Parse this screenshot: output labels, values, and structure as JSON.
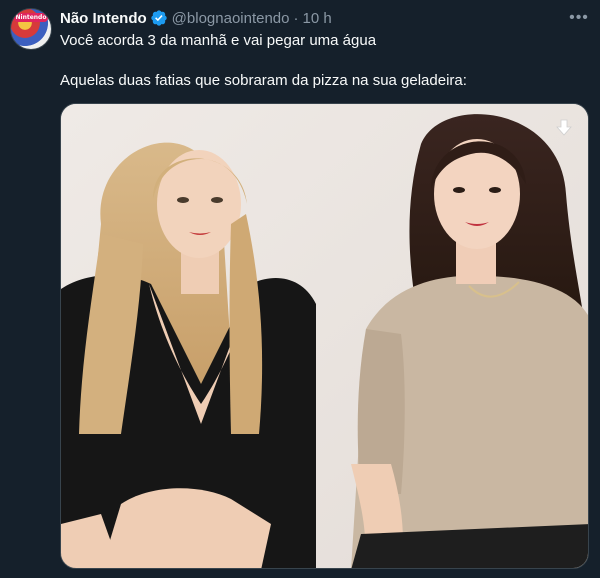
{
  "tweet": {
    "author_name": "Não Intendo",
    "handle": "@blognaointendo",
    "separator": "·",
    "time": "10 h",
    "avatar_label": "Nintendo",
    "text_line1": "Você acorda 3 da manhã e vai pegar uma água",
    "text_line2": "Aquelas duas fatias que sobraram da pizza na sua geladeira:",
    "more_label": "•••"
  },
  "icons": {
    "verified": "verified-badge-icon",
    "more": "more-options-icon",
    "download": "download-arrow-icon"
  },
  "colors": {
    "background": "#15202b",
    "text_primary": "#f7f9f9",
    "text_secondary": "#8b98a5",
    "verified_blue": "#1d9bf0",
    "border": "#38444d"
  }
}
